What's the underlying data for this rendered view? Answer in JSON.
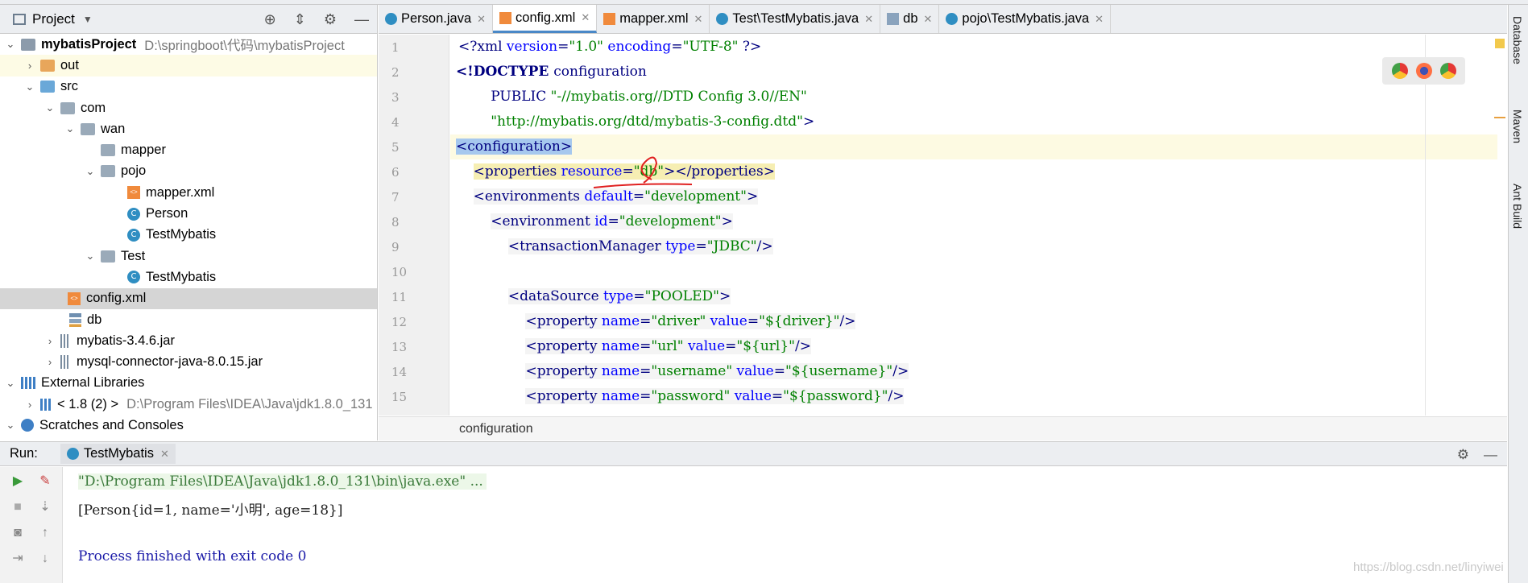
{
  "project_panel": {
    "title": "Project",
    "tree": [
      {
        "label": "mybatisProject",
        "path": "D:\\springboot\\代码\\mybatisProject",
        "icon": "module-folder-icon"
      },
      {
        "label": "out",
        "icon": "folder-orange-icon"
      },
      {
        "label": "src",
        "icon": "folder-source-icon"
      },
      {
        "label": "com",
        "icon": "package-icon"
      },
      {
        "label": "wan",
        "icon": "package-icon"
      },
      {
        "label": "mapper",
        "icon": "package-icon"
      },
      {
        "label": "pojo",
        "icon": "package-icon"
      },
      {
        "label": "mapper.xml",
        "icon": "xml-file-icon"
      },
      {
        "label": "Person",
        "icon": "class-icon"
      },
      {
        "label": "TestMybatis",
        "icon": "class-icon"
      },
      {
        "label": "Test",
        "icon": "package-icon"
      },
      {
        "label": "TestMybatis",
        "icon": "class-icon"
      },
      {
        "label": "config.xml",
        "icon": "xml-file-icon"
      },
      {
        "label": "db",
        "icon": "properties-file-icon"
      },
      {
        "label": "mybatis-3.4.6.jar",
        "icon": "jar-icon"
      },
      {
        "label": "mysql-connector-java-8.0.15.jar",
        "icon": "jar-icon"
      },
      {
        "label": "External Libraries",
        "icon": "library-icon"
      },
      {
        "label": "< 1.8 (2) >",
        "path": "D:\\Program Files\\IDEA\\Java\\jdk1.8.0_131",
        "icon": "jdk-icon"
      },
      {
        "label": "Scratches and Consoles",
        "icon": "scratch-icon"
      }
    ]
  },
  "tabs": [
    {
      "label": "Person.java",
      "icon": "class-icon"
    },
    {
      "label": "config.xml",
      "icon": "xml-file-icon",
      "active": true
    },
    {
      "label": "mapper.xml",
      "icon": "xml-file-icon"
    },
    {
      "label": "Test\\TestMybatis.java",
      "icon": "class-icon"
    },
    {
      "label": "db",
      "icon": "properties-file-icon"
    },
    {
      "label": "pojo\\TestMybatis.java",
      "icon": "class-icon"
    }
  ],
  "editor": {
    "line_numbers": [
      "1",
      "2",
      "3",
      "4",
      "5",
      "6",
      "7",
      "8",
      "9",
      "10",
      "11",
      "12",
      "13",
      "14",
      "15"
    ],
    "lines": {
      "l1_a": "<?xml ",
      "l1_b": "version",
      "l1_c": "=",
      "l1_d": "\"1.0\"",
      "l1_e": " encoding",
      "l1_f": "=",
      "l1_g": "\"UTF-8\"",
      "l1_h": " ?>",
      "l2_a": "<!DOCTYPE ",
      "l2_b": "configuration",
      "l3_a": "        PUBLIC ",
      "l3_b": "\"-//mybatis.org//DTD Config 3.0//EN\"",
      "l4_a": "        ",
      "l4_b": "\"http://mybatis.org/dtd/mybatis-3-config.dtd\"",
      "l4_c": ">",
      "l5": "<configuration>",
      "l6_a": "    ",
      "l6_b": "<properties ",
      "l6_c": "resource",
      "l6_d": "=",
      "l6_e": "\"db\"",
      "l6_f": "></properties>",
      "l7_a": "    ",
      "l7_b": "<environments ",
      "l7_c": "default",
      "l7_d": "=",
      "l7_e": "\"development\"",
      "l7_f": ">",
      "l8_a": "        ",
      "l8_b": "<environment ",
      "l8_c": "id",
      "l8_d": "=",
      "l8_e": "\"development\"",
      "l8_f": ">",
      "l9_a": "            ",
      "l9_b": "<transactionManager ",
      "l9_c": "type",
      "l9_d": "=",
      "l9_e": "\"JDBC\"",
      "l9_f": "/>",
      "l11_a": "            ",
      "l11_b": "<dataSource ",
      "l11_c": "type",
      "l11_d": "=",
      "l11_e": "\"POOLED\"",
      "l11_f": ">",
      "l12_a": "                ",
      "l12_b": "<property ",
      "l12_c": "name",
      "l12_d": "=",
      "l12_e": "\"driver\"",
      "l12_f": " value",
      "l12_g": "=",
      "l12_h": "\"${driver}\"",
      "l12_i": "/>",
      "l13_a": "                ",
      "l13_b": "<property ",
      "l13_c": "name",
      "l13_d": "=",
      "l13_e": "\"url\"",
      "l13_f": " value",
      "l13_g": "=",
      "l13_h": "\"${url}\"",
      "l13_i": "/>",
      "l14_a": "                ",
      "l14_b": "<property ",
      "l14_c": "name",
      "l14_d": "=",
      "l14_e": "\"username\"",
      "l14_f": " value",
      "l14_g": "=",
      "l14_h": "\"${username}\"",
      "l14_i": "/>",
      "l15_a": "                ",
      "l15_b": "<property ",
      "l15_c": "name",
      "l15_d": "=",
      "l15_e": "\"password\"",
      "l15_f": " value",
      "l15_g": "=",
      "l15_h": "\"${password}\"",
      "l15_i": "/>"
    },
    "breadcrumb": "configuration"
  },
  "right_strip": [
    "Database",
    "Maven",
    "Ant Build"
  ],
  "run_panel": {
    "label": "Run:",
    "tab": "TestMybatis",
    "console": [
      "\"D:\\Program Files\\IDEA\\Java\\jdk1.8.0_131\\bin\\java.exe\" ...",
      "[Person{id=1, name='小明', age=18}]",
      "Process finished with exit code 0"
    ]
  },
  "watermark": "https://blog.csdn.net/linyiwei"
}
